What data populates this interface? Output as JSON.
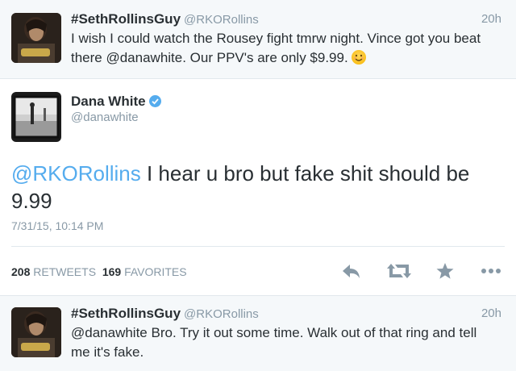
{
  "tweet1": {
    "name": "#SethRollinsGuy",
    "handle": "@RKORollins",
    "time": "20h",
    "text": "I wish I could watch the Rousey fight tmrw night. Vince got you beat there @danawhite. Our PPV's are only $9.99."
  },
  "main_tweet": {
    "name": "Dana White",
    "handle": "@danawhite",
    "mention": "@RKORollins",
    "text": " I hear u bro but fake shit should be 9.99",
    "date": "7/31/15, 10:14 PM",
    "retweets_count": "208",
    "retweets_label": "RETWEETS",
    "favorites_count": "169",
    "favorites_label": "FAVORITES",
    "icons": [
      "reply-icon",
      "retweet-icon",
      "favorite-icon",
      "more-icon"
    ]
  },
  "tweet2": {
    "name": "#SethRollinsGuy",
    "handle": "@RKORollins",
    "time": "20h",
    "text": "@danawhite Bro. Try it out some time. Walk out of that ring and tell me it's fake."
  },
  "colors": {
    "link": "#55acee",
    "secondary_text": "#8899a6",
    "primary_text": "#292f33",
    "action_icon": "#8899a6"
  }
}
